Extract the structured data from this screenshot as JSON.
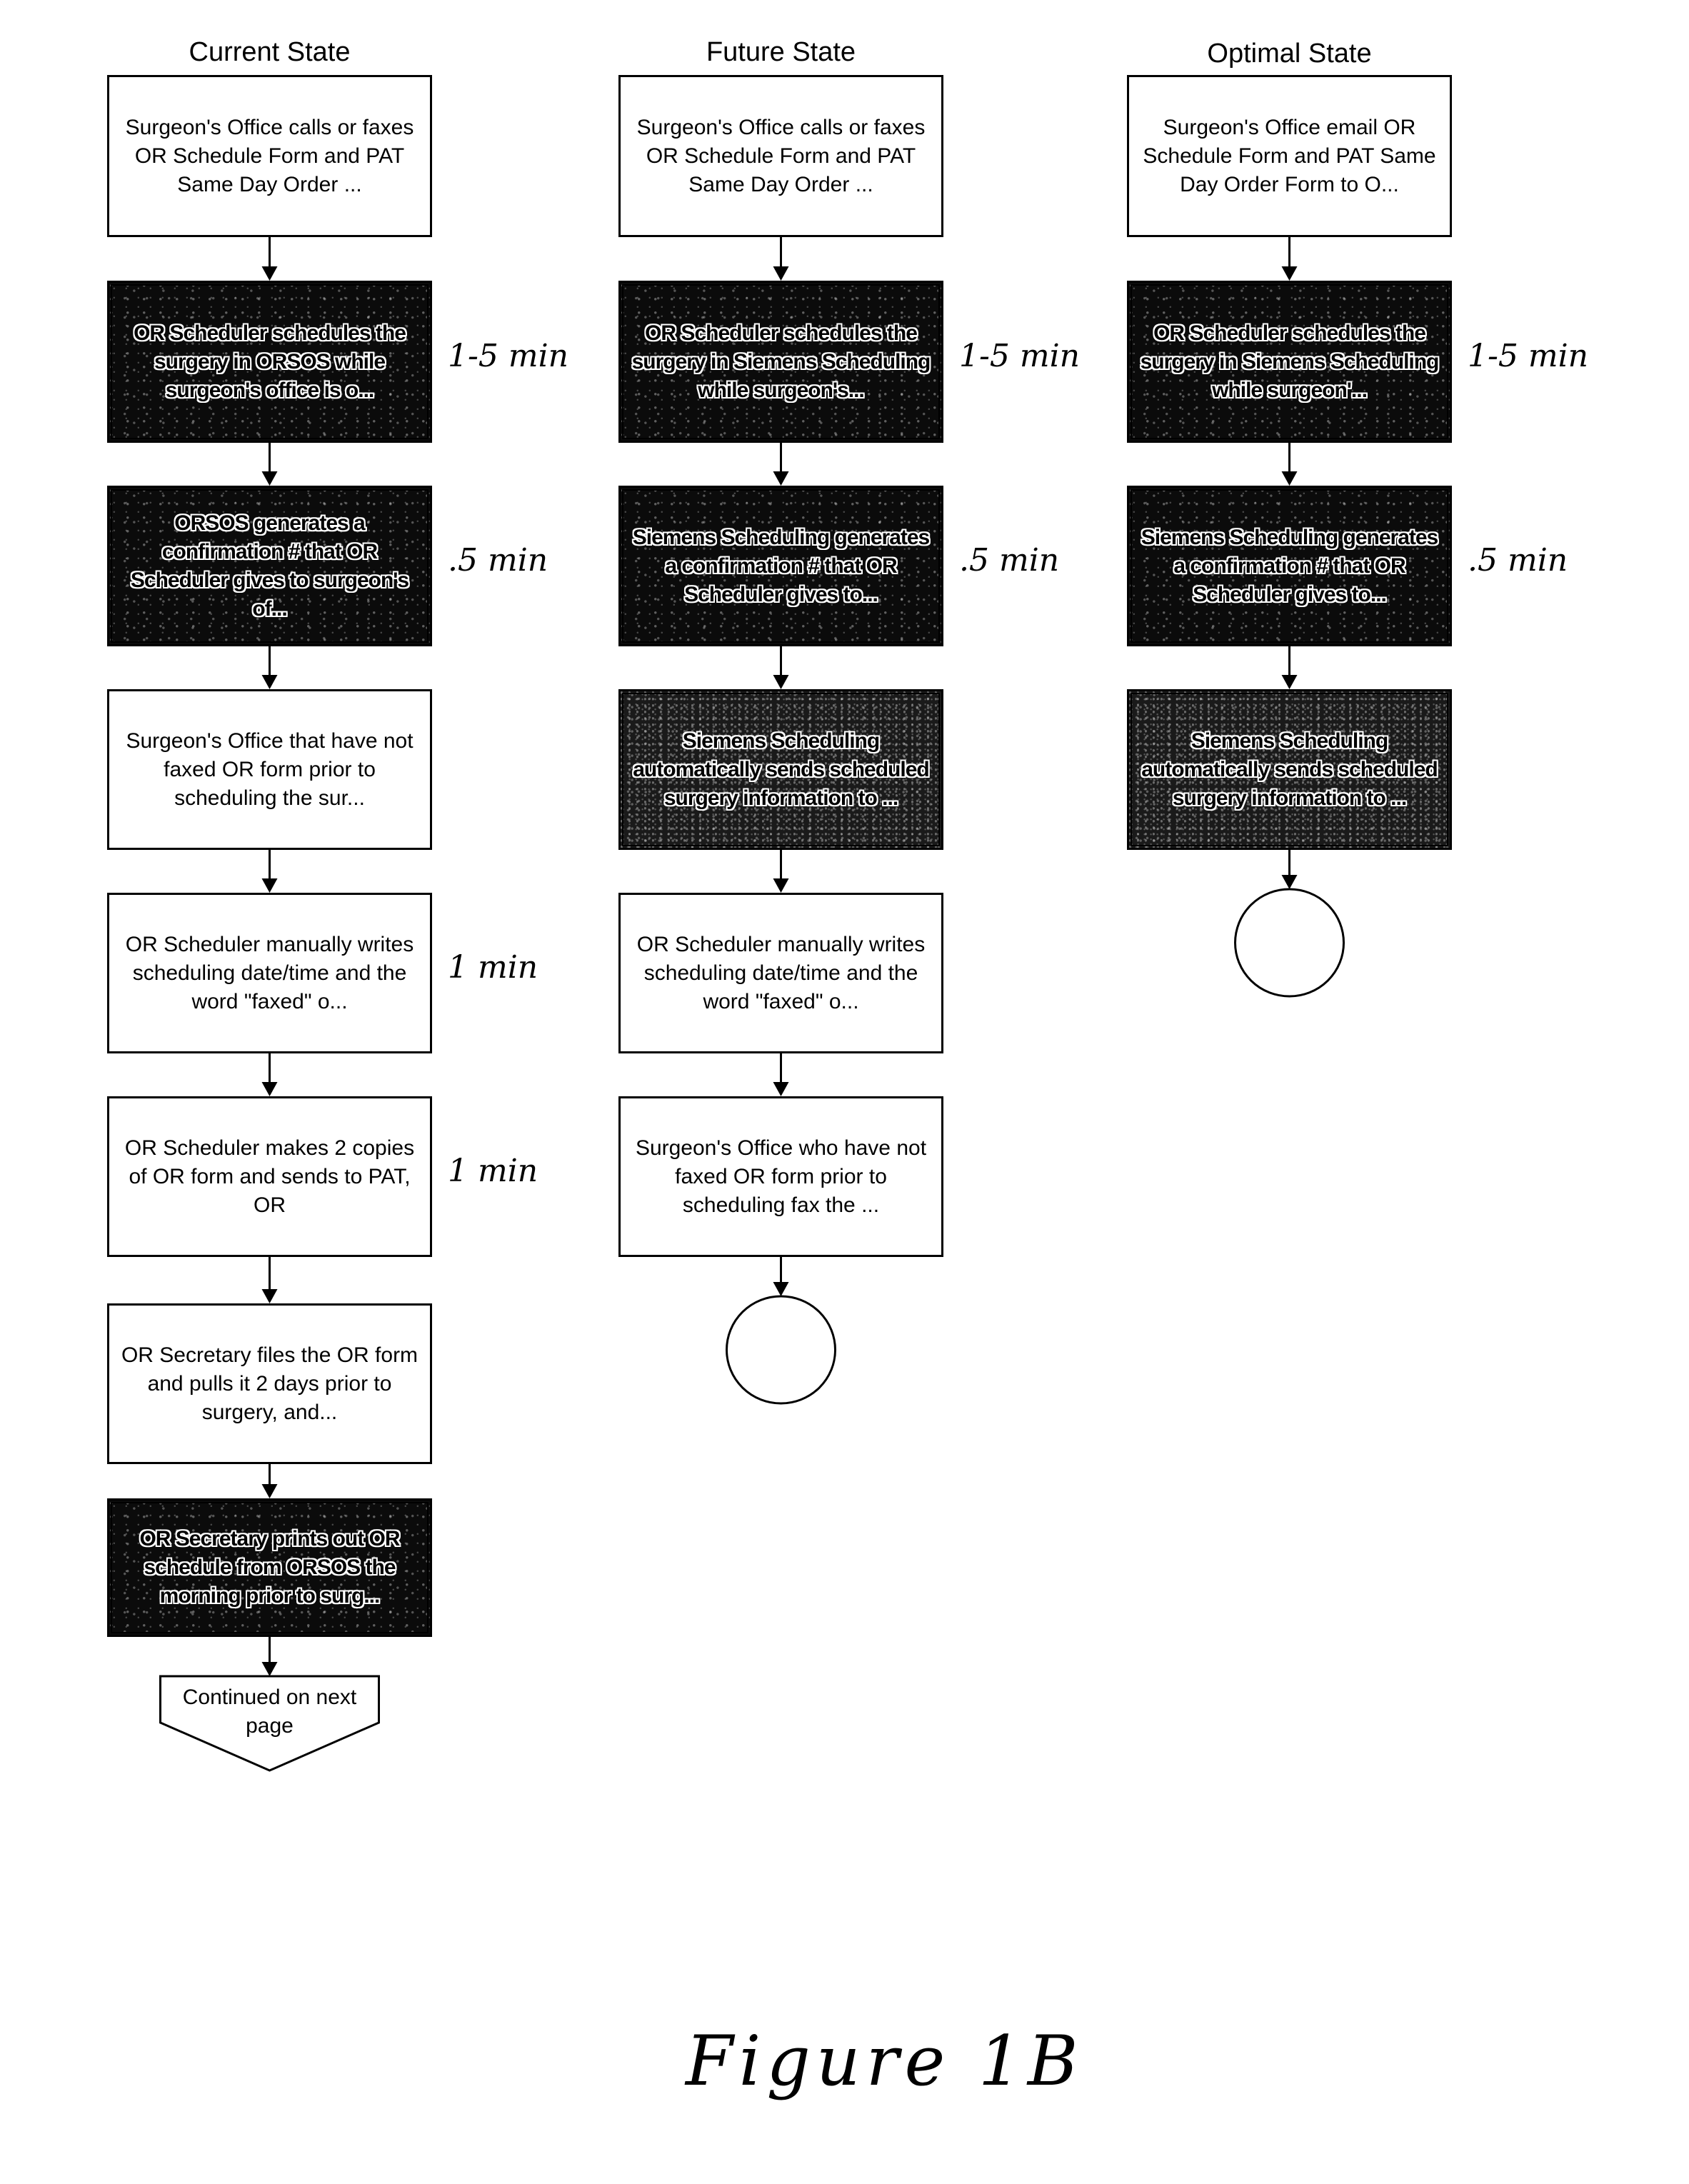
{
  "columns": [
    {
      "title": "Current State",
      "steps": [
        {
          "text": "Surgeon's Office calls or faxes OR Schedule Form and PAT Same Day Order ...",
          "style": "plain",
          "time": ""
        },
        {
          "text": "OR Scheduler schedules the surgery in ORSOS while surgeon's office is o...",
          "style": "dark",
          "time": "1-5 min"
        },
        {
          "text": "ORSOS generates a confirmation # that OR Scheduler gives to surgeon's of...",
          "style": "dark",
          "time": ".5 min"
        },
        {
          "text": "Surgeon's Office that have not faxed OR form prior to scheduling the sur...",
          "style": "plain",
          "time": ""
        },
        {
          "text": "OR Scheduler manually writes scheduling date/time and the word \"faxed\" o...",
          "style": "plain",
          "time": "1 min"
        },
        {
          "text": "OR Scheduler makes 2 copies of OR form and sends to PAT, OR",
          "style": "plain",
          "time": "1 min"
        },
        {
          "text": "OR Secretary files the OR form and pulls it 2 days prior to surgery, and...",
          "style": "plain",
          "time": ""
        },
        {
          "text": "OR Secretary prints out OR schedule from ORSOS the morning prior to surg...",
          "style": "dark",
          "time": ""
        }
      ],
      "end": {
        "type": "offpage-connector",
        "text": "Continued on next page"
      }
    },
    {
      "title": "Future State",
      "steps": [
        {
          "text": "Surgeon's Office calls or faxes OR Schedule Form and PAT Same Day Order ...",
          "style": "plain",
          "time": ""
        },
        {
          "text": "OR Scheduler schedules the surgery in Siemens Scheduling while surgeon's...",
          "style": "dark",
          "time": "1-5 min"
        },
        {
          "text": "Siemens Scheduling generates a confirmation # that OR Scheduler gives to...",
          "style": "dark",
          "time": ".5 min"
        },
        {
          "text": "Siemens Scheduling automatically sends scheduled surgery information to ...",
          "style": "speckled",
          "time": ""
        },
        {
          "text": "OR Scheduler manually writes scheduling date/time and the word \"faxed\" o...",
          "style": "plain",
          "time": ""
        },
        {
          "text": "Surgeon's Office who have not faxed OR form prior to scheduling fax the ...",
          "style": "plain",
          "time": ""
        }
      ],
      "end": {
        "type": "terminator-circle",
        "text": ""
      }
    },
    {
      "title": "Optimal State",
      "steps": [
        {
          "text": "Surgeon's Office email OR Schedule Form and PAT Same Day Order Form to O...",
          "style": "plain",
          "time": ""
        },
        {
          "text": "OR Scheduler schedules the surgery in Siemens Scheduling while surgeon'...",
          "style": "dark",
          "time": "1-5 min"
        },
        {
          "text": "Siemens Scheduling generates a confirmation # that OR Scheduler gives to...",
          "style": "dark",
          "time": ".5 min"
        },
        {
          "text": "Siemens Scheduling automatically sends scheduled surgery information to ...",
          "style": "speckled",
          "time": ""
        }
      ],
      "end": {
        "type": "terminator-circle",
        "text": ""
      }
    }
  ],
  "caption": "Figure 1B"
}
